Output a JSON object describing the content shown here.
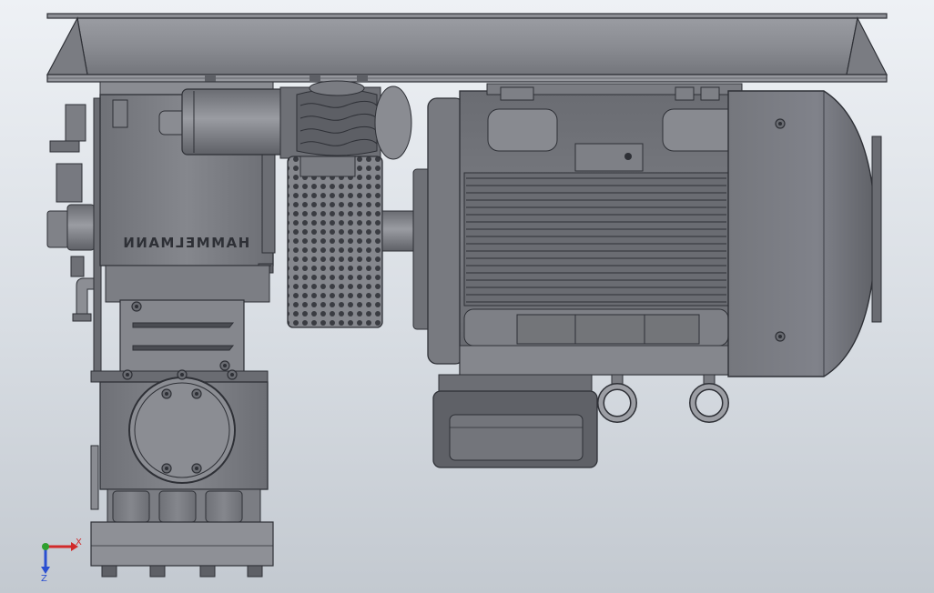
{
  "viewport": {
    "background_top": "#eef1f5",
    "background_bottom": "#c3c9d0"
  },
  "model": {
    "brand_label": "HAMMELMANN",
    "brand_label_mirrored": true,
    "body_color": "#7b7d83",
    "edge_color": "#2e3036"
  },
  "triad": {
    "x_label": "X",
    "z_label": "Z",
    "x_color": "#d12a2a",
    "y_color": "#2fa02f",
    "z_color": "#2a4fd1"
  }
}
